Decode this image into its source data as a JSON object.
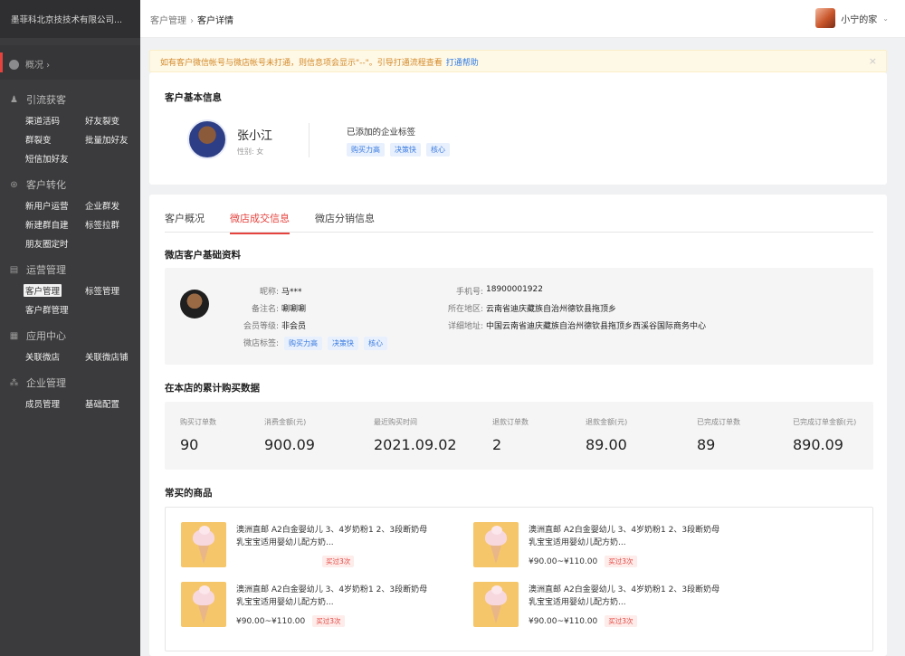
{
  "sidebar": {
    "company": "墨菲科北京技技术有限公司...",
    "overview": "概况 ›",
    "groups": [
      {
        "title": "引流获客",
        "items": [
          "渠道活码",
          "好友裂变",
          "群裂变",
          "批量加好友",
          "短信加好友"
        ]
      },
      {
        "title": "客户转化",
        "items": [
          "新用户运营",
          "企业群发",
          "新建群自建",
          "标签拉群",
          "朋友圈定时"
        ]
      },
      {
        "title": "运营管理",
        "items": [
          "客户管理",
          "标签管理",
          "客户群管理"
        ]
      },
      {
        "title": "应用中心",
        "items": [
          "关联微店",
          "关联微店铺"
        ]
      },
      {
        "title": "企业管理",
        "items": [
          "成员管理",
          "基础配置"
        ]
      }
    ]
  },
  "topbar": {
    "breadcrumb_parent": "客户管理",
    "breadcrumb_sep": "›",
    "breadcrumb_current": "客户详情",
    "user_name": "小宁的家"
  },
  "notice": {
    "text": "如有客户微信帐号与微店帐号未打通，则信息项会显示\"--\"。引导打通流程查看",
    "link": "打通帮助",
    "close": "×"
  },
  "basic": {
    "title": "客户基本信息",
    "name": "张小江",
    "gender": "性别: 女",
    "tags_title": "已添加的企业标签",
    "tags": [
      "购买力高",
      "决策快",
      "核心"
    ]
  },
  "tabs": [
    "客户概况",
    "微店成交信息",
    "微店分销信息"
  ],
  "profile": {
    "title": "微店客户基础资料",
    "nickname_label": "昵称:",
    "nickname": "马***",
    "remark_label": "备注名:",
    "remark": "唰唰唰",
    "level_label": "会员等级:",
    "level": "非会员",
    "tags_label": "微店标签:",
    "tags": [
      "购买力高",
      "决策快",
      "核心"
    ],
    "phone_label": "手机号:",
    "phone": "18900001922",
    "region_label": "所在地区:",
    "region": "云南省迪庆藏族自治州德钦县拖顶乡",
    "address_label": "详细地址:",
    "address": "中国云南省迪庆藏族自治州德钦县拖顶乡西溪谷国际商务中心"
  },
  "stats": {
    "title": "在本店的累计购买数据",
    "items": [
      {
        "label": "购买订单数",
        "value": "90"
      },
      {
        "label": "消费金额(元)",
        "value": "900.09"
      },
      {
        "label": "最近购买时间",
        "value": "2021.09.02"
      },
      {
        "label": "退款订单数",
        "value": "2"
      },
      {
        "label": "退款金额(元)",
        "value": "89.00"
      },
      {
        "label": "已完成订单数",
        "value": "89"
      },
      {
        "label": "已完成订单金额(元)",
        "value": "890.09"
      }
    ]
  },
  "goods": {
    "title": "常买的商品",
    "items": [
      {
        "name": "澳洲直邮  A2白金婴幼儿 3、4岁奶粉1 2、3段断奶母乳宝宝适用婴幼儿配方奶...",
        "price": "",
        "badge": "买过3次"
      },
      {
        "name": "澳洲直邮  A2白金婴幼儿 3、4岁奶粉1 2、3段断奶母乳宝宝适用婴幼儿配方奶...",
        "price": "¥90.00~¥110.00",
        "badge": "买过3次"
      },
      {
        "name": "澳洲直邮  A2白金婴幼儿 3、4岁奶粉1 2、3段断奶母乳宝宝适用婴幼儿配方奶...",
        "price": "¥90.00~¥110.00",
        "badge": "买过3次"
      },
      {
        "name": "澳洲直邮  A2白金婴幼儿 3、4岁奶粉1 2、3段断奶母乳宝宝适用婴幼儿配方奶...",
        "price": "¥90.00~¥110.00",
        "badge": "买过3次"
      }
    ]
  }
}
